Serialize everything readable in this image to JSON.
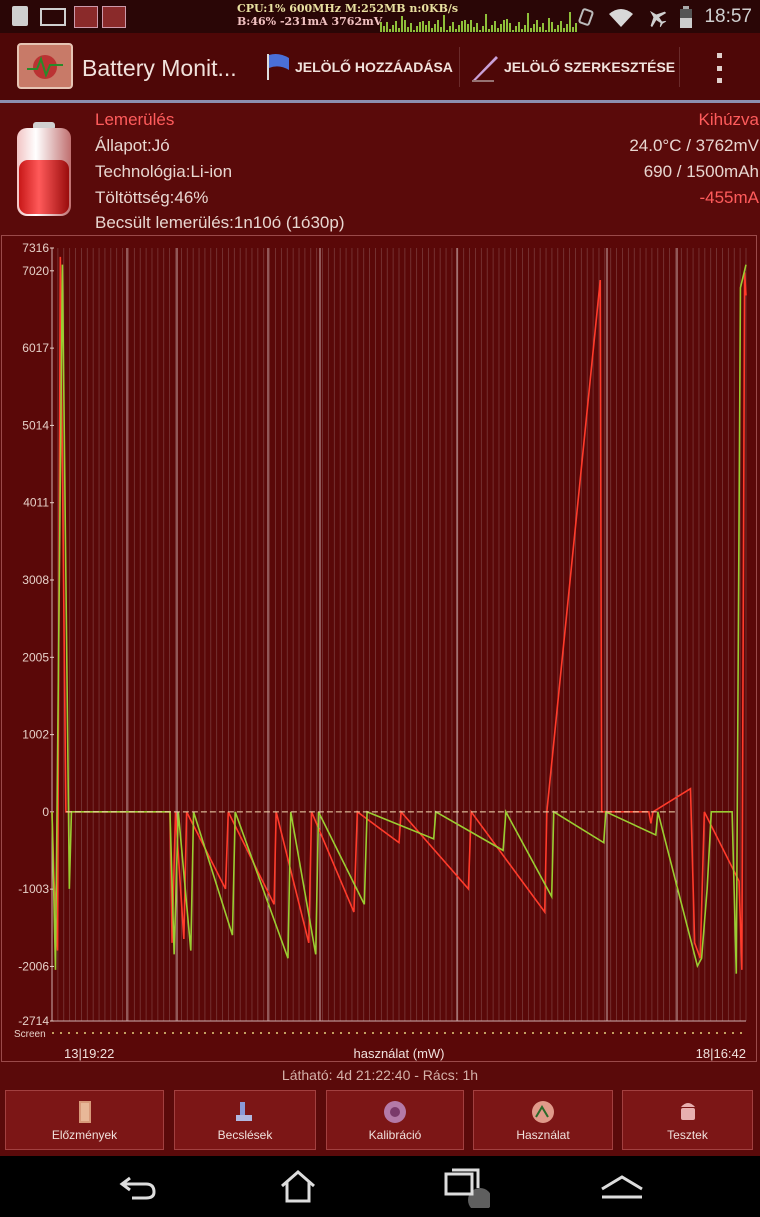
{
  "status_bar": {
    "cpu_line": "CPU:1% 600MHz M:252MB n:0KB/s",
    "battery_line": "B:46% -231mA 3762mV",
    "clock": "18:57"
  },
  "action_bar": {
    "title": "Battery Monit...",
    "add_marker": "JELÖLŐ HOZZÁADÁSA",
    "edit_marker": "JELÖLŐ SZERKESZTÉSE"
  },
  "info": {
    "status": "Lemerülés",
    "plug": "Kihúzva",
    "health": "Állapot:Jó",
    "temp_voltage": "24.0°C / 3762mV",
    "technology": "Technológia:Li-ion",
    "capacity": "690 / 1500mAh",
    "level": "Töltöttség:46%",
    "current": "-455mA",
    "estimate": "Becsült lemerülés:1n10ó (1ó30p)"
  },
  "chart_data": {
    "type": "line",
    "xlabel": "használat (mW)",
    "x_start": "13|19:22",
    "x_end": "18|16:42",
    "screen_label": "Screen",
    "ylim": [
      -2714,
      7316
    ],
    "yticks": [
      "7316",
      "7020",
      "6017",
      "5014",
      "4011",
      "3008",
      "2005",
      "1002",
      "0",
      "-1003",
      "-2006",
      "-2714"
    ],
    "series": [
      {
        "color": "#ff3b2b",
        "values": [
          [
            0,
            0
          ],
          [
            0.3,
            -900
          ],
          [
            0.8,
            -1800
          ],
          [
            1.2,
            7200
          ],
          [
            2.0,
            0
          ],
          [
            17,
            0
          ],
          [
            17.3,
            -1700
          ],
          [
            17.8,
            0
          ],
          [
            19,
            -1650
          ],
          [
            19.4,
            0
          ],
          [
            25,
            -1000
          ],
          [
            25.4,
            0
          ],
          [
            32,
            -1200
          ],
          [
            32.3,
            0
          ],
          [
            37,
            -1700
          ],
          [
            37.4,
            0
          ],
          [
            43.5,
            -1300
          ],
          [
            44,
            0
          ],
          [
            50,
            -400
          ],
          [
            50.3,
            0
          ],
          [
            60,
            -1000
          ],
          [
            60.4,
            0
          ],
          [
            71,
            -1300
          ],
          [
            71.3,
            0
          ],
          [
            79,
            6900
          ],
          [
            79.2,
            0
          ],
          [
            86,
            0
          ],
          [
            86.3,
            -150
          ],
          [
            86.6,
            0
          ],
          [
            92,
            300
          ],
          [
            92.6,
            -1700
          ],
          [
            93.4,
            -1900
          ],
          [
            94,
            0
          ],
          [
            99,
            -900
          ],
          [
            99.4,
            -2050
          ],
          [
            99.8,
            7000
          ],
          [
            100,
            6700
          ]
        ]
      },
      {
        "color": "#9acd32",
        "values": [
          [
            0,
            0
          ],
          [
            0.5,
            -2050
          ],
          [
            1.5,
            7100
          ],
          [
            2.5,
            -1000
          ],
          [
            2.8,
            0
          ],
          [
            17,
            0
          ],
          [
            17.6,
            -1850
          ],
          [
            18.2,
            0
          ],
          [
            20,
            -1800
          ],
          [
            20.4,
            0
          ],
          [
            26,
            -1600
          ],
          [
            26.4,
            0
          ],
          [
            34,
            -1900
          ],
          [
            34.4,
            0
          ],
          [
            38,
            -1850
          ],
          [
            38.4,
            0
          ],
          [
            45,
            -1200
          ],
          [
            45.4,
            0
          ],
          [
            55,
            -350
          ],
          [
            55.3,
            0
          ],
          [
            65,
            -500
          ],
          [
            65.4,
            0
          ],
          [
            72,
            -1100
          ],
          [
            72.3,
            0
          ],
          [
            79.5,
            -400
          ],
          [
            79.8,
            0
          ],
          [
            87,
            -300
          ],
          [
            87.3,
            0
          ],
          [
            93,
            -2000
          ],
          [
            93.6,
            -1900
          ],
          [
            94.4,
            -1000
          ],
          [
            95,
            0
          ],
          [
            98,
            0
          ],
          [
            98.6,
            -2100
          ],
          [
            99.2,
            6800
          ],
          [
            100,
            7100
          ]
        ]
      }
    ]
  },
  "visible": "Látható: 4d 21:22:40 - Rács: 1h",
  "tabs": [
    {
      "label": "Előzmények"
    },
    {
      "label": "Becslések"
    },
    {
      "label": "Kalibráció"
    },
    {
      "label": "Használat"
    },
    {
      "label": "Tesztek"
    }
  ]
}
